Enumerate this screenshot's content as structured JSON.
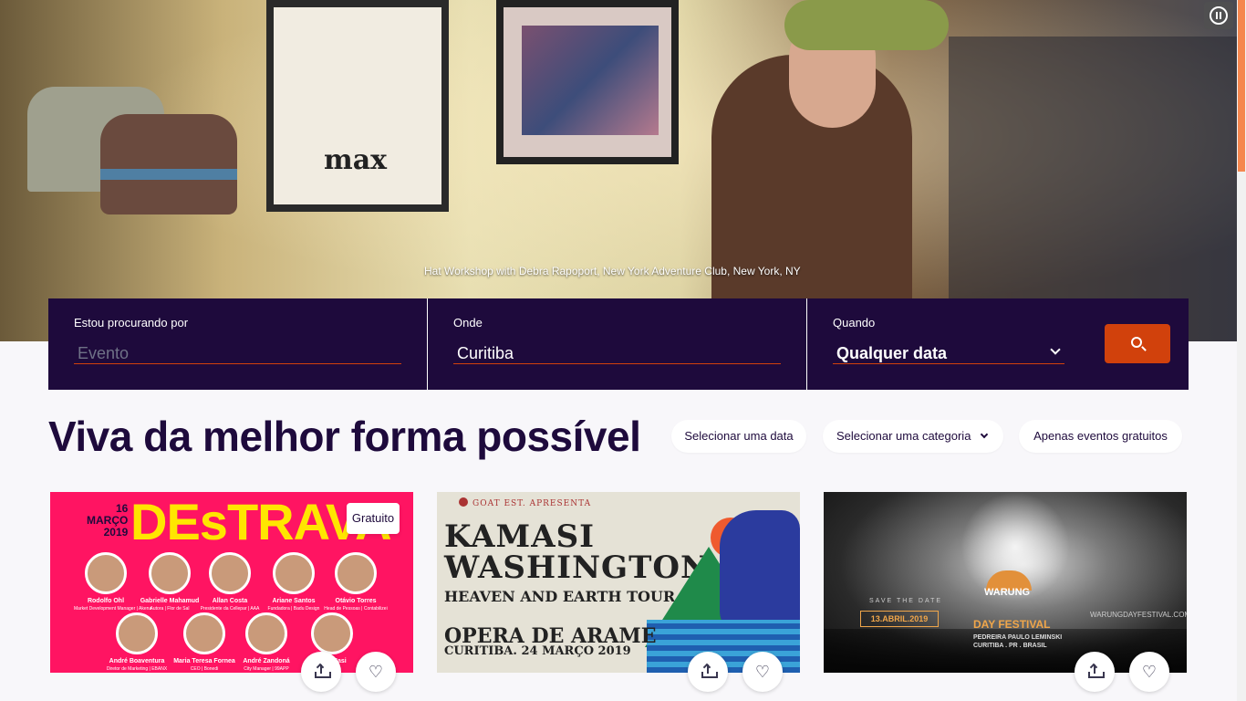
{
  "hero": {
    "caption": "Hat Workshop with Debra Rapoport, New York Adventure Club, New York, NY",
    "poster_text": "max",
    "pause_icon": "pause-circle-icon"
  },
  "search": {
    "what_label": "Estou procurando por",
    "what_placeholder": "Evento",
    "where_label": "Onde",
    "where_value": "Curitiba",
    "when_label": "Quando",
    "when_value": "Qualquer data",
    "button_icon": "search-icon"
  },
  "headline": "Viva da melhor forma possível",
  "filters": {
    "date": "Selecionar uma data",
    "category": "Selecionar uma categoria",
    "free": "Apenas eventos gratuitos"
  },
  "cards": [
    {
      "badge": "Gratuito",
      "poster": {
        "date": "16\nMARÇO\n2019",
        "brand": "DEsTRAVA",
        "speakers": [
          {
            "name": "Rodolfo Ohl",
            "role": "Market Development Manager | Akena"
          },
          {
            "name": "Gabrielle Mahamud",
            "role": "Autora | Flor de Sal"
          },
          {
            "name": "Allan Costa",
            "role": "Presidente da Cellepar | AAA"
          },
          {
            "name": "Ariane Santos",
            "role": "Fundadora | Badu Design"
          },
          {
            "name": "Otávio Torres",
            "role": "Head de Pessoas | Contabilizei"
          },
          {
            "name": "André Boaventura",
            "role": "Diretor de Marketing | EBANX"
          },
          {
            "name": "Maria Teresa Fornea",
            "role": "CEO | Bonedi"
          },
          {
            "name": "André Zandoná",
            "role": "City Manager | 99APP"
          },
          {
            "name": "Luiz Masi",
            "role": ""
          }
        ]
      }
    },
    {
      "badge": "",
      "poster": {
        "presents": "GOAT EST. APRESENTA",
        "title1": "KAMASI",
        "title2": "WASHINGTON",
        "tour": "HEAVEN AND EARTH TOUR",
        "venue": "OPERA DE ARAME",
        "city_date": "CURITIBA. 24 MARÇO 2019"
      }
    },
    {
      "badge": "",
      "poster": {
        "save": "SAVE THE DATE",
        "date": "13.ABRIL.2019",
        "logo_top": "WARUNG",
        "logo_bottom": "DAY FESTIVAL",
        "venue": "PEDREIRA PAULO LEMINSKI",
        "city": "CURITIBA . PR . BRASIL",
        "site": "WARUNGDAYFESTIVAL.COM"
      }
    }
  ],
  "actions": {
    "share_icon": "share-upload-icon",
    "like_icon": "heart-icon",
    "heart_glyph": "♡"
  },
  "colors": {
    "brand_dark": "#1e0a3c",
    "accent": "#d1410c",
    "background": "#f8f7fa"
  }
}
